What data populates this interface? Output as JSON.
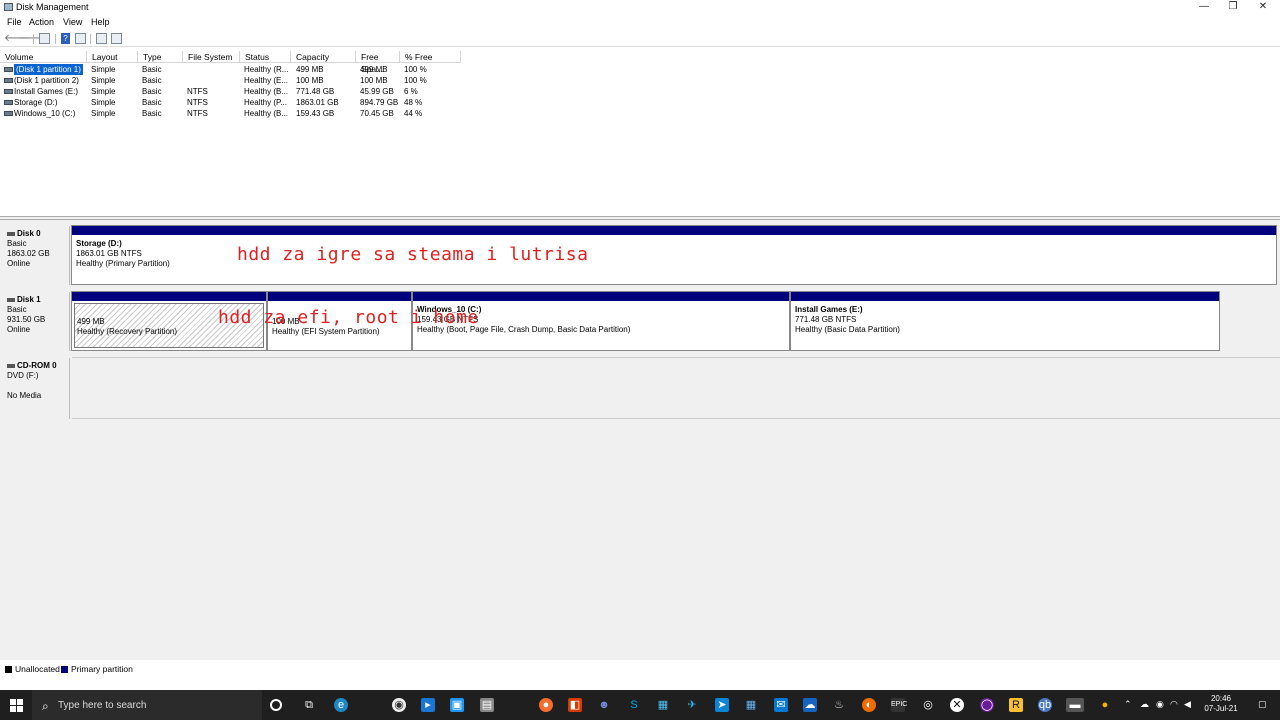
{
  "window": {
    "title": "Disk Management",
    "controls": {
      "minimize": "—",
      "restore": "❐",
      "close": "✕"
    }
  },
  "menu": [
    "File",
    "Action",
    "View",
    "Help"
  ],
  "toolbar": {
    "back": "🡐",
    "forward": "🡒",
    "help": "?"
  },
  "columns": [
    "Volume",
    "Layout",
    "Type",
    "File System",
    "Status",
    "Capacity",
    "Free Spa...",
    "% Free"
  ],
  "volumes": [
    {
      "volume": "(Disk 1 partition 1)",
      "layout": "Simple",
      "type": "Basic",
      "fs": "",
      "status": "Healthy (R...",
      "capacity": "499 MB",
      "free": "499 MB",
      "pct": "100 %"
    },
    {
      "volume": "(Disk 1 partition 2)",
      "layout": "Simple",
      "type": "Basic",
      "fs": "",
      "status": "Healthy (E...",
      "capacity": "100 MB",
      "free": "100 MB",
      "pct": "100 %"
    },
    {
      "volume": "Install Games (E:)",
      "layout": "Simple",
      "type": "Basic",
      "fs": "NTFS",
      "status": "Healthy (B...",
      "capacity": "771.48 GB",
      "free": "45.99 GB",
      "pct": "6 %"
    },
    {
      "volume": "Storage (D:)",
      "layout": "Simple",
      "type": "Basic",
      "fs": "NTFS",
      "status": "Healthy (P...",
      "capacity": "1863.01 GB",
      "free": "894.79 GB",
      "pct": "48 %"
    },
    {
      "volume": "Windows_10 (C:)",
      "layout": "Simple",
      "type": "Basic",
      "fs": "NTFS",
      "status": "Healthy (B...",
      "capacity": "159.43 GB",
      "free": "70.45 GB",
      "pct": "44 %"
    }
  ],
  "disks": {
    "disk0": {
      "name": "Disk 0",
      "type": "Basic",
      "size": "1863.02 GB",
      "state": "Online",
      "p1": {
        "name": "Storage  (D:)",
        "size": "1863.01 GB NTFS",
        "status": "Healthy (Primary Partition)"
      }
    },
    "disk1": {
      "name": "Disk 1",
      "type": "Basic",
      "size": "931.50 GB",
      "state": "Online",
      "p1": {
        "size": "499 MB",
        "status": "Healthy (Recovery Partition)"
      },
      "p2": {
        "size": "100 MB",
        "status": "Healthy (EFI System Partition)"
      },
      "p3": {
        "name": "Windows_10  (C:)",
        "size": "159.43 GB NTFS",
        "status": "Healthy (Boot, Page File, Crash Dump, Basic Data Partition)"
      },
      "p4": {
        "name": "Install Games  (E:)",
        "size": "771.48 GB NTFS",
        "status": "Healthy (Basic Data Partition)"
      }
    },
    "cdrom0": {
      "name": "CD-ROM 0",
      "type": "DVD (F:)",
      "state": "No Media"
    }
  },
  "annotations": {
    "disk0": "hdd za igre sa steama i lutrisa",
    "disk1": "hdd za efi, root i home"
  },
  "legend": {
    "unallocated": "Unallocated",
    "primary": "Primary partition",
    "unallocated_color": "#000000",
    "primary_color": "#00007f"
  },
  "taskbar": {
    "search_placeholder": "Type here to search",
    "icons": [
      "cortana-icon",
      "task-view-icon",
      "edge-icon",
      "media-player-icon",
      "mail-app-icon",
      "photos-icon",
      "store-icon",
      "origin-icon",
      "office-icon",
      "discord-icon",
      "skype-icon",
      "gallery-icon",
      "telegram-icon",
      "calendar-icon",
      "outlook-icon",
      "cloud-icon",
      "steam-icon",
      "blitz-icon",
      "epic-games-icon",
      "vpn-icon",
      "xbox-icon",
      "obs-icon",
      "rockstar-icon",
      "qbittorrent-icon",
      "disk-management-icon"
    ],
    "time": "20:46",
    "date": "07-Jul-21"
  },
  "colors": {
    "primary": "#00007f",
    "annotation": "#e02020",
    "taskbar": "#1f1f1f",
    "selection": "#0a64d0"
  }
}
